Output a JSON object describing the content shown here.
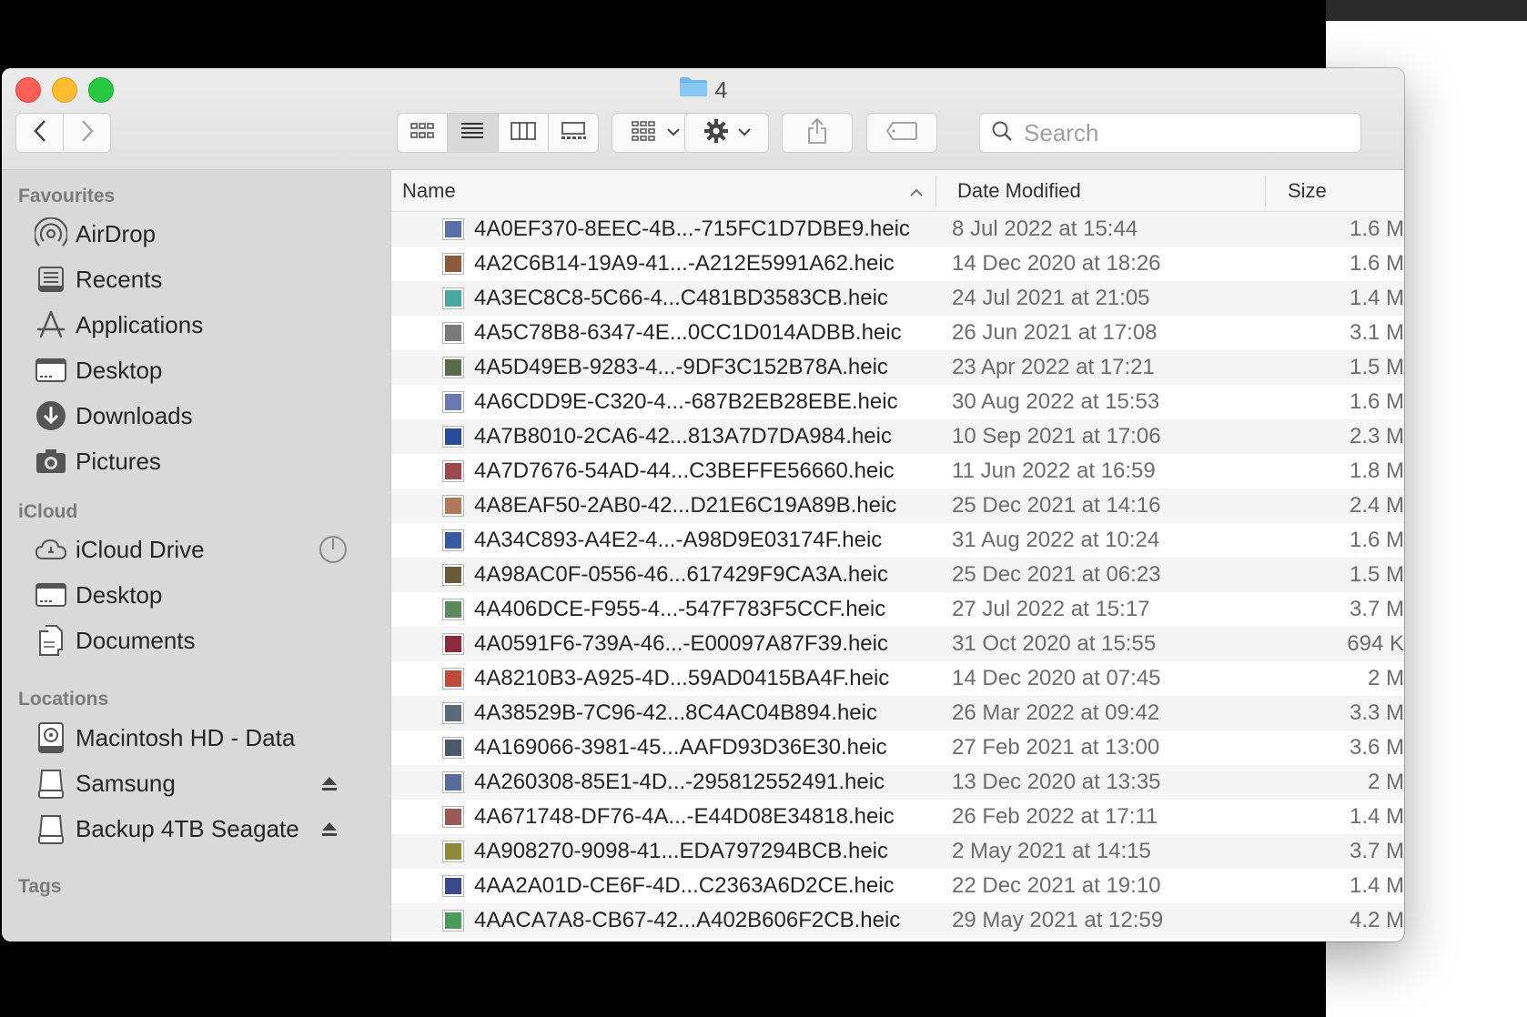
{
  "window": {
    "title": "4"
  },
  "toolbar": {
    "back_icon": "chevron-left-icon",
    "forward_icon": "chevron-right-icon",
    "views": [
      "icon-view-icon",
      "list-view-icon",
      "column-view-icon",
      "gallery-view-icon"
    ],
    "active_view": "list-view-icon",
    "group_icon": "group-icon",
    "action_icon": "gear-icon",
    "share_icon": "share-icon",
    "tag_icon": "tag-icon",
    "search_placeholder": "Search"
  },
  "sidebar": {
    "favourites_label": "Favourites",
    "favourites": [
      {
        "label": "AirDrop",
        "icon": "airdrop-icon"
      },
      {
        "label": "Recents",
        "icon": "recents-icon"
      },
      {
        "label": "Applications",
        "icon": "applications-icon"
      },
      {
        "label": "Desktop",
        "icon": "desktop-icon"
      },
      {
        "label": "Downloads",
        "icon": "downloads-icon"
      },
      {
        "label": "Pictures",
        "icon": "pictures-icon"
      }
    ],
    "icloud_label": "iCloud",
    "icloud": [
      {
        "label": "iCloud Drive",
        "icon": "icloud-icon",
        "trail": "progress-icon"
      },
      {
        "label": "Desktop",
        "icon": "desktop-icon"
      },
      {
        "label": "Documents",
        "icon": "documents-icon"
      }
    ],
    "locations_label": "Locations",
    "locations": [
      {
        "label": "Macintosh HD - Data",
        "icon": "hard-disk-icon"
      },
      {
        "label": "Samsung",
        "icon": "external-drive-icon",
        "trail": "eject-icon"
      },
      {
        "label": "Backup 4TB Seagate",
        "icon": "external-drive-icon",
        "trail": "eject-icon"
      }
    ],
    "tags_label": "Tags"
  },
  "columns": {
    "name": "Name",
    "date": "Date Modified",
    "size": "Size"
  },
  "files": [
    {
      "name": "4A0EF370-8EEC-4B...-715FC1D7DBE9.heic",
      "date": "8 Jul 2022 at 15:44",
      "size": "1.6 M",
      "color": "#5a6fa8"
    },
    {
      "name": "4A2C6B14-19A9-41...-A212E5991A62.heic",
      "date": "14 Dec 2020 at 18:26",
      "size": "1.6 M",
      "color": "#8a5a3a"
    },
    {
      "name": "4A3EC8C8-5C66-4...C481BD3583CB.heic",
      "date": "24 Jul 2021 at 21:05",
      "size": "1.4 M",
      "color": "#4aa8a0"
    },
    {
      "name": "4A5C78B8-6347-4E...0CC1D014ADBB.heic",
      "date": "26 Jun 2021 at 17:08",
      "size": "3.1 M",
      "color": "#7a7a7a"
    },
    {
      "name": "4A5D49EB-9283-4...-9DF3C152B78A.heic",
      "date": "23 Apr 2022 at 17:21",
      "size": "1.5 M",
      "color": "#5a6a4a"
    },
    {
      "name": "4A6CDD9E-C320-4...-687B2EB28EBE.heic",
      "date": "30 Aug 2022 at 15:53",
      "size": "1.6 M",
      "color": "#6a7ab0"
    },
    {
      "name": "4A7B8010-2CA6-42...813A7D7DA984.heic",
      "date": "10 Sep 2021 at 17:06",
      "size": "2.3 M",
      "color": "#2a4a9a"
    },
    {
      "name": "4A7D7676-54AD-44...C3BEFFE56660.heic",
      "date": "11 Jun 2022 at 16:59",
      "size": "1.8 M",
      "color": "#9a4a4a"
    },
    {
      "name": "4A8EAF50-2AB0-42...D21E6C19A89B.heic",
      "date": "25 Dec 2021 at 14:16",
      "size": "2.4 M",
      "color": "#b07a5a"
    },
    {
      "name": "4A34C893-A4E2-4...-A98D9E03174F.heic",
      "date": "31 Aug 2022 at 10:24",
      "size": "1.6 M",
      "color": "#3a5aa0"
    },
    {
      "name": "4A98AC0F-0556-46...617429F9CA3A.heic",
      "date": "25 Dec 2021 at 06:23",
      "size": "1.5 M",
      "color": "#6a5a3a"
    },
    {
      "name": "4A406DCE-F955-4...-547F783F5CCF.heic",
      "date": "27 Jul 2022 at 15:17",
      "size": "3.7 M",
      "color": "#5a8a5a"
    },
    {
      "name": "4A0591F6-739A-46...-E00097A87F39.heic",
      "date": "31 Oct 2020 at 15:55",
      "size": "694 K",
      "color": "#8a2a3a"
    },
    {
      "name": "4A8210B3-A925-4D...59AD0415BA4F.heic",
      "date": "14 Dec 2020 at 07:45",
      "size": "2 M",
      "color": "#c04a3a"
    },
    {
      "name": "4A38529B-7C96-42...8C4AC04B894.heic",
      "date": "26 Mar 2022 at 09:42",
      "size": "3.3 M",
      "color": "#5a6a7a"
    },
    {
      "name": "4A169066-3981-45...AAFD93D36E30.heic",
      "date": "27 Feb 2021 at 13:00",
      "size": "3.6 M",
      "color": "#4a5a6a"
    },
    {
      "name": "4A260308-85E1-4D...-295812552491.heic",
      "date": "13 Dec 2020 at 13:35",
      "size": "2 M",
      "color": "#5a6a9a"
    },
    {
      "name": "4A671748-DF76-4A...-E44D08E34818.heic",
      "date": "26 Feb 2022 at 17:11",
      "size": "1.4 M",
      "color": "#9a5a5a"
    },
    {
      "name": "4A908270-9098-41...EDA797294BCB.heic",
      "date": "2 May 2021 at 14:15",
      "size": "3.7 M",
      "color": "#8a8a3a"
    },
    {
      "name": "4AA2A01D-CE6F-4D...C2363A6D2CE.heic",
      "date": "22 Dec 2021 at 19:10",
      "size": "1.4 M",
      "color": "#3a4a8a"
    },
    {
      "name": "4AACA7A8-CB67-42...A402B606F2CB.heic",
      "date": "29 May 2021 at 12:59",
      "size": "4.2 M",
      "color": "#4a9a5a"
    }
  ]
}
